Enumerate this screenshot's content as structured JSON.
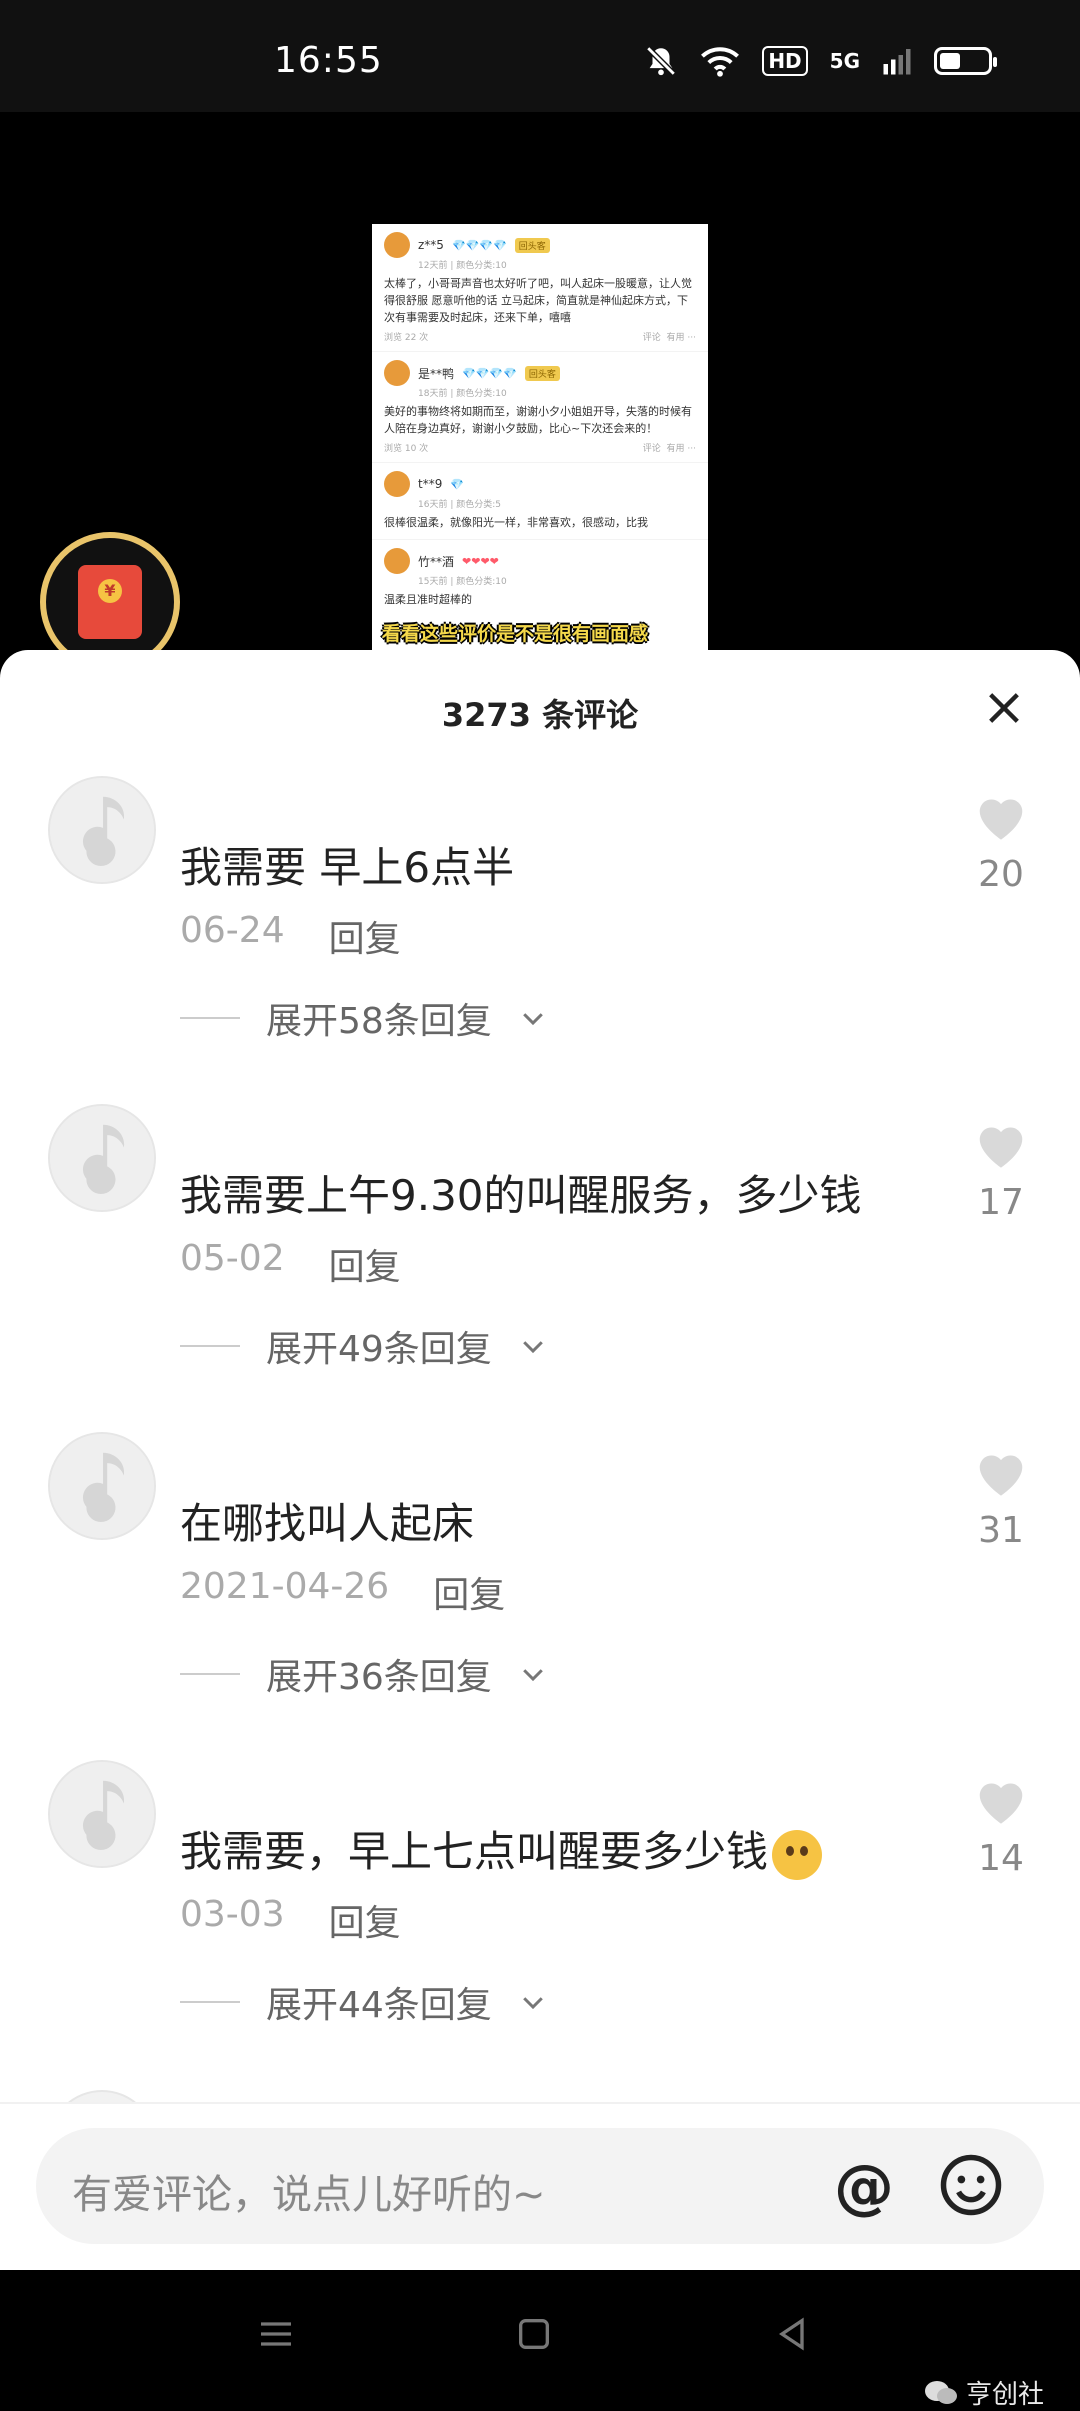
{
  "status_bar": {
    "time": "16:55",
    "hd": "HD",
    "network": "5G"
  },
  "screenshot_reviews": [
    {
      "user": "z**5",
      "diamonds": "💎💎💎💎",
      "tag": "回头客",
      "date": "12天前 | 颜色分类:10",
      "text": "太棒了，小哥哥声音也太好听了吧，叫人起床一股暖意，让人觉得很舒服 愿意听他的话 立马起床，简直就是神仙起床方式，下次有事需要及时起床，还来下单，嘻嘻",
      "views": "浏览 22 次",
      "comment": "评论",
      "useful": "有用"
    },
    {
      "user": "是**鸭",
      "diamonds": "💎💎💎💎",
      "tag": "回头客",
      "date": "18天前 | 颜色分类:10",
      "text": "美好的事物终将如期而至，谢谢小夕小姐姐开导，失落的时候有人陪在身边真好，谢谢小夕鼓励，比心~下次还会来的！",
      "views": "浏览 10 次",
      "comment": "评论",
      "useful": "有用"
    },
    {
      "user": "t**9",
      "diamonds": "💎",
      "tag": "",
      "date": "16天前 | 颜色分类:5",
      "text": "很棒很温柔，就像阳光一样，非常喜欢，很感动，比我",
      "views": "",
      "comment": "",
      "useful": ""
    },
    {
      "user": "竹**酒",
      "diamonds": "❤❤❤❤",
      "tag": "",
      "date": "15天前 | 颜色分类:10",
      "text": "温柔且准时超棒的",
      "views": "",
      "comment": "",
      "useful": ""
    }
  ],
  "overlay_caption": "看看这些评价是不是很有画面感",
  "panel": {
    "title": "3273 条评论"
  },
  "comments": [
    {
      "text": "我需要 早上6点半",
      "date": "06-24",
      "reply": "回复",
      "expand": "展开58条回复",
      "likes": "20"
    },
    {
      "text": "我需要上午9.30的叫醒服务，多少钱",
      "date": "05-02",
      "reply": "回复",
      "expand": "展开49条回复",
      "likes": "17"
    },
    {
      "text": "在哪找叫人起床",
      "date": "2021-04-26",
      "reply": "回复",
      "expand": "展开36条回复",
      "likes": "31"
    },
    {
      "text": "我需要，早上七点叫醒要多少钱",
      "date": "03-03",
      "reply": "回复",
      "expand": "展开44条回复",
      "likes": "14"
    }
  ],
  "input": {
    "placeholder": "有爱评论，说点儿好听的~",
    "at": "@"
  },
  "watermark": "亨创社"
}
